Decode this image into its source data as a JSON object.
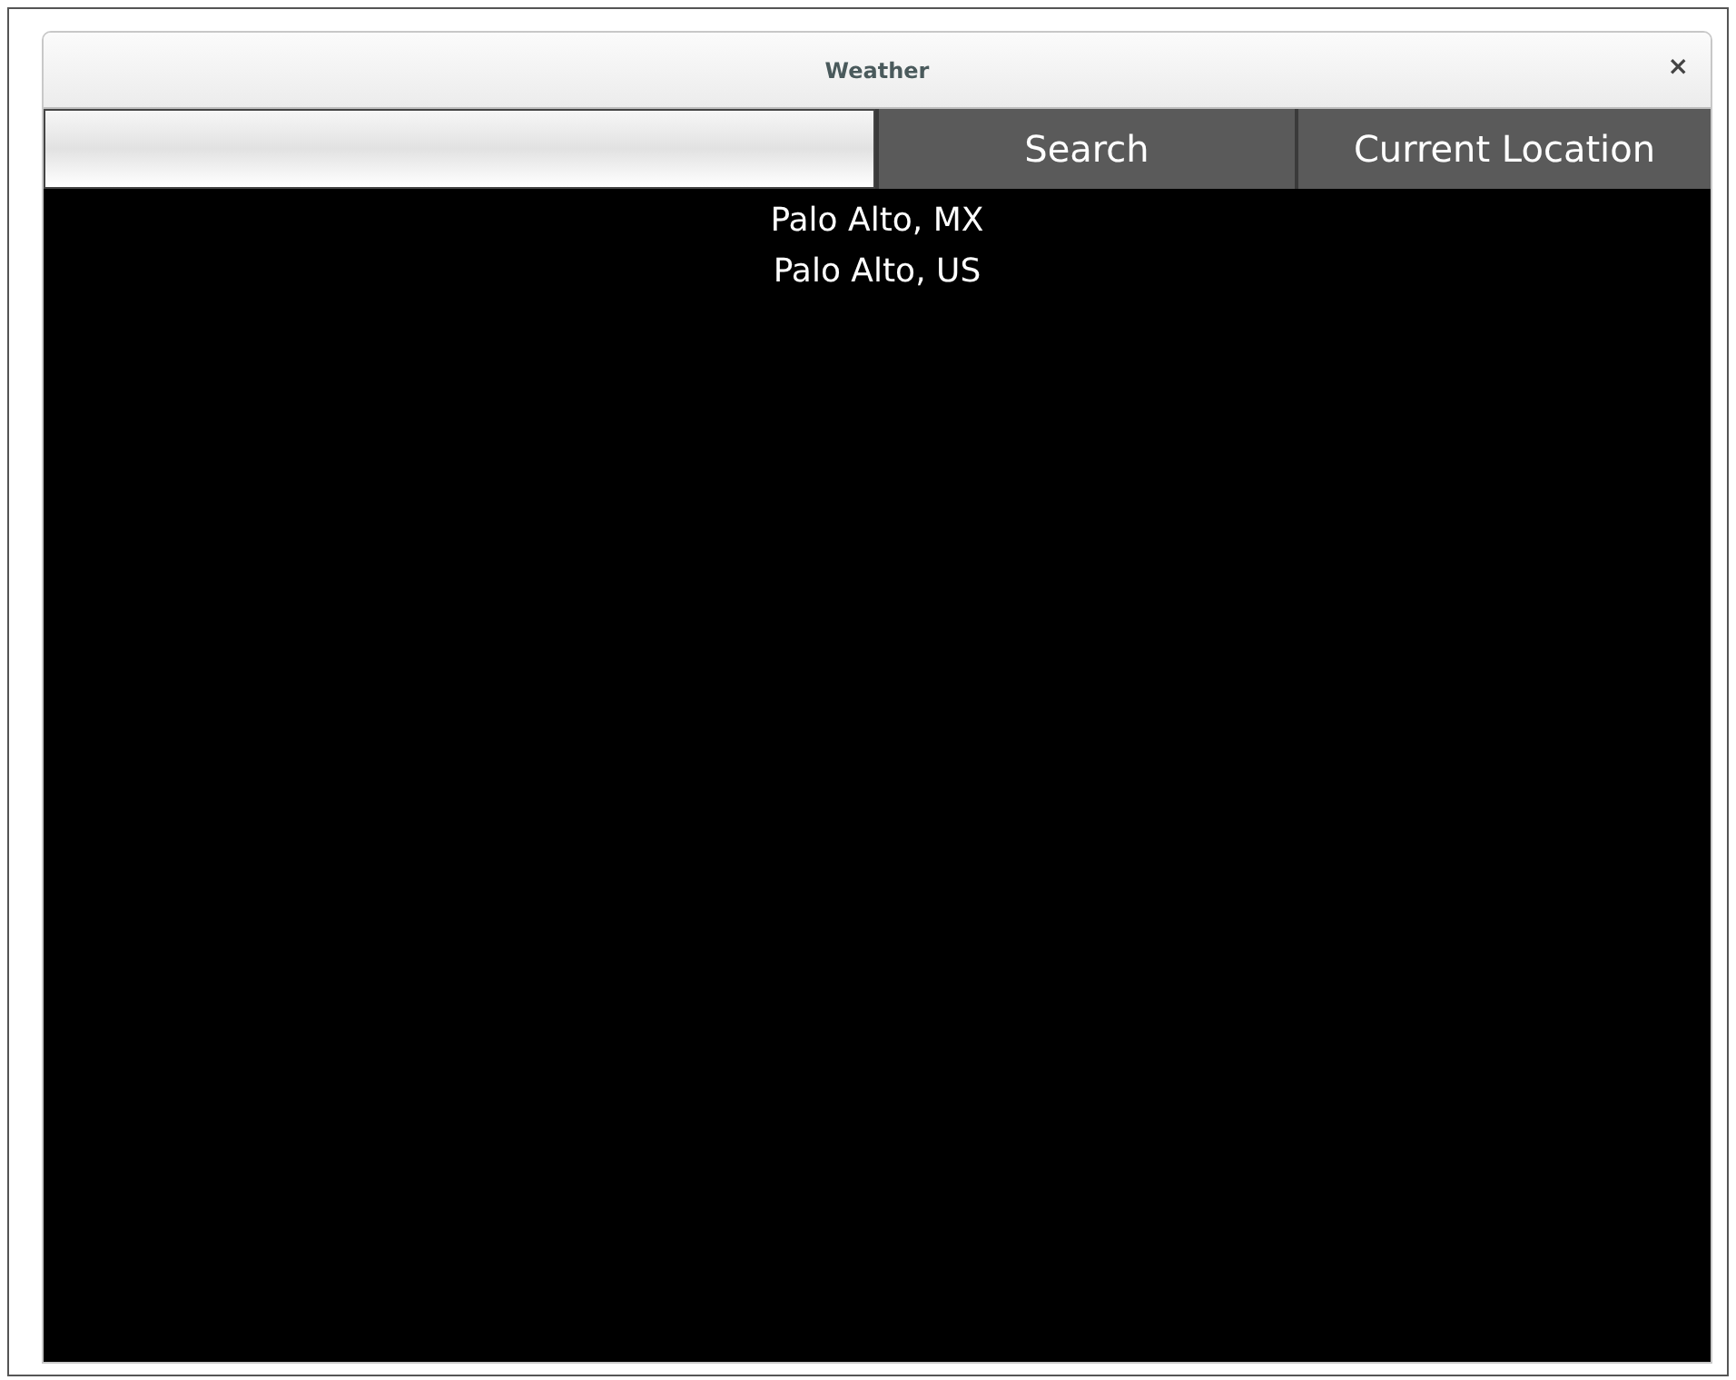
{
  "window": {
    "title": "Weather",
    "close": "×"
  },
  "toolbar": {
    "buttons": [
      "Search",
      "Current Location"
    ]
  },
  "results": [
    "Palo Alto, MX",
    "Palo Alto, US"
  ]
}
